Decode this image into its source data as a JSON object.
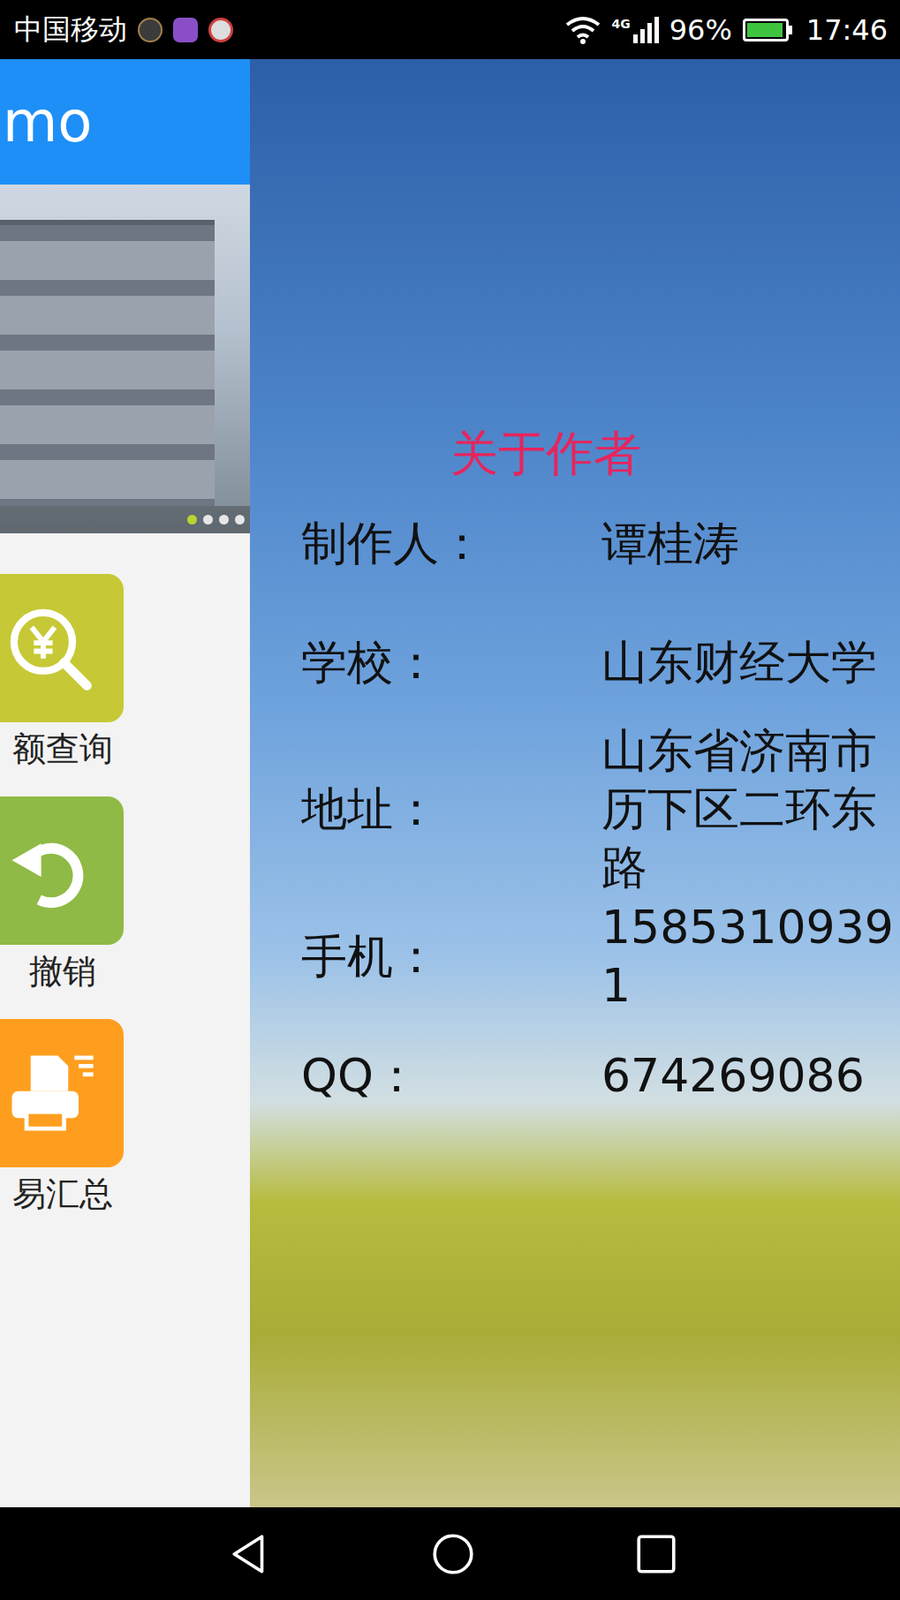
{
  "status_bar": {
    "carrier": "中国移动",
    "network": "4G",
    "battery": "96%",
    "battery_level": 0.96,
    "time": "17:46"
  },
  "main": {
    "title": "mo",
    "carousel_dots": [
      {
        "selected": true
      },
      {
        "selected": false
      },
      {
        "selected": false
      },
      {
        "selected": false
      }
    ],
    "tiles": [
      {
        "label": "额查询",
        "color": "#c6c935",
        "kind": "search"
      },
      {
        "label": "撤销",
        "color": "#8fba45",
        "kind": "undo"
      },
      {
        "label": "易汇总",
        "color": "#ff9e1e",
        "kind": "print"
      }
    ]
  },
  "about": {
    "title": "关于作者",
    "rows": [
      {
        "label": "制作人：",
        "value": "谭桂涛"
      },
      {
        "label": "学校：",
        "value": "山东财经大学"
      },
      {
        "label": "地址：",
        "value": "山东省济南市历下区二环东路"
      },
      {
        "label": "手机：",
        "value": "15853109391"
      },
      {
        "label": "QQ：",
        "value": "674269086"
      }
    ]
  }
}
